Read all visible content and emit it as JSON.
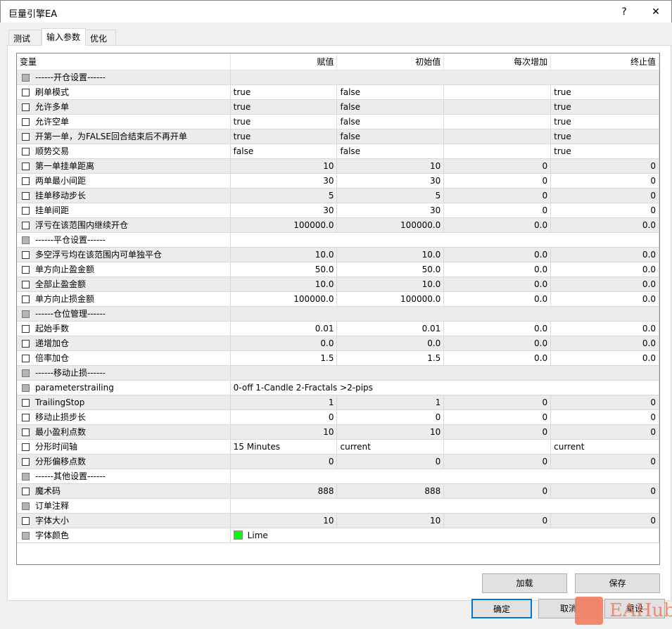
{
  "window": {
    "title": "巨量引擎EA",
    "help": "?",
    "close": "✕"
  },
  "tabs": [
    {
      "label": "测试"
    },
    {
      "label": "输入参数"
    },
    {
      "label": "优化"
    }
  ],
  "columns": [
    "变量",
    "赋值",
    "初始值",
    "每次增加",
    "终止值"
  ],
  "rows": [
    {
      "name": "------开仓设置------",
      "disabled": true,
      "span": ""
    },
    {
      "name": "刷单模式",
      "v": [
        "true",
        "false",
        "",
        "true"
      ]
    },
    {
      "name": "允许多单",
      "v": [
        "true",
        "false",
        "",
        "true"
      ]
    },
    {
      "name": "允许空单",
      "v": [
        "true",
        "false",
        "",
        "true"
      ]
    },
    {
      "name": "开第一单，为FALSE回合结束后不再开单",
      "v": [
        "true",
        "false",
        "",
        "true"
      ]
    },
    {
      "name": "顺势交易",
      "v": [
        "false",
        "false",
        "",
        "true"
      ]
    },
    {
      "name": "第一单挂单距离",
      "v": [
        "10",
        "10",
        "0",
        "0"
      ]
    },
    {
      "name": "两单最小间距",
      "v": [
        "30",
        "30",
        "0",
        "0"
      ]
    },
    {
      "name": "挂单移动步长",
      "v": [
        "5",
        "5",
        "0",
        "0"
      ]
    },
    {
      "name": "挂单间距",
      "v": [
        "30",
        "30",
        "0",
        "0"
      ]
    },
    {
      "name": "浮亏在该范围内继续开仓",
      "v": [
        "100000.0",
        "100000.0",
        "0.0",
        "0.0"
      ]
    },
    {
      "name": "------平仓设置------",
      "disabled": true,
      "span": ""
    },
    {
      "name": "多空浮亏均在该范围内可单独平仓",
      "v": [
        "10.0",
        "10.0",
        "0.0",
        "0.0"
      ]
    },
    {
      "name": "单方向止盈金额",
      "v": [
        "50.0",
        "50.0",
        "0.0",
        "0.0"
      ]
    },
    {
      "name": "全部止盈金额",
      "v": [
        "10.0",
        "10.0",
        "0.0",
        "0.0"
      ]
    },
    {
      "name": "单方向止损金额",
      "v": [
        "100000.0",
        "100000.0",
        "0.0",
        "0.0"
      ]
    },
    {
      "name": "------仓位管理------",
      "disabled": true,
      "span": ""
    },
    {
      "name": "起始手数",
      "v": [
        "0.01",
        "0.01",
        "0.0",
        "0.0"
      ]
    },
    {
      "name": "递增加仓",
      "v": [
        "0.0",
        "0.0",
        "0.0",
        "0.0"
      ]
    },
    {
      "name": "倍率加仓",
      "v": [
        "1.5",
        "1.5",
        "0.0",
        "0.0"
      ]
    },
    {
      "name": "------移动止损------",
      "disabled": true,
      "span": ""
    },
    {
      "name": "parameterstrailing",
      "disabled": true,
      "span": "0-off  1-Candle  2-Fractals  >2-pips"
    },
    {
      "name": "TrailingStop",
      "v": [
        "1",
        "1",
        "0",
        "0"
      ]
    },
    {
      "name": "移动止损步长",
      "v": [
        "0",
        "0",
        "0",
        "0"
      ]
    },
    {
      "name": "最小盈利点数",
      "v": [
        "10",
        "10",
        "0",
        "0"
      ]
    },
    {
      "name": "分形时间轴",
      "v": [
        "15 Minutes",
        "current",
        "",
        "current"
      ]
    },
    {
      "name": "分形偏移点数",
      "v": [
        "0",
        "0",
        "0",
        "0"
      ]
    },
    {
      "name": "------其他设置------",
      "disabled": true,
      "span": ""
    },
    {
      "name": "魔术码",
      "v": [
        "888",
        "888",
        "0",
        "0"
      ]
    },
    {
      "name": "订单注释",
      "disabled": true,
      "span": ""
    },
    {
      "name": "字体大小",
      "v": [
        "10",
        "10",
        "0",
        "0"
      ]
    },
    {
      "name": "字体颜色",
      "disabled": true,
      "span": "Lime",
      "color": "#00ff00"
    }
  ],
  "buttons": {
    "load": "加载",
    "save": "保存",
    "ok": "确定",
    "cancel": "取消",
    "reset": "重设"
  },
  "watermark": "EAHub"
}
